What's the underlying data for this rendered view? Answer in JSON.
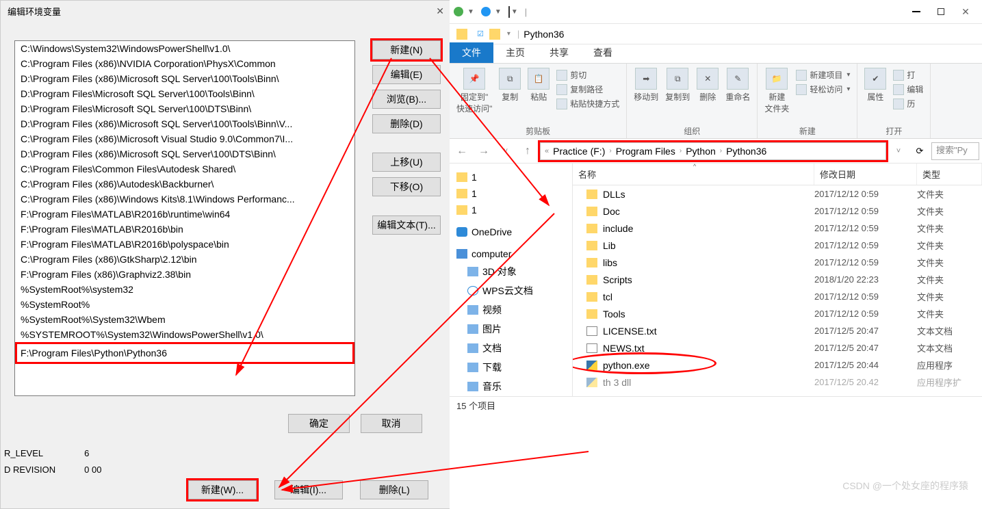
{
  "envdlg": {
    "title": "编辑环境变量",
    "items": [
      "C:\\Windows\\System32\\WindowsPowerShell\\v1.0\\",
      "C:\\Program Files (x86)\\NVIDIA Corporation\\PhysX\\Common",
      "D:\\Program Files (x86)\\Microsoft SQL Server\\100\\Tools\\Binn\\",
      "D:\\Program Files\\Microsoft SQL Server\\100\\Tools\\Binn\\",
      "D:\\Program Files\\Microsoft SQL Server\\100\\DTS\\Binn\\",
      "D:\\Program Files (x86)\\Microsoft SQL Server\\100\\Tools\\Binn\\V...",
      "C:\\Program Files (x86)\\Microsoft Visual Studio 9.0\\Common7\\I...",
      "D:\\Program Files (x86)\\Microsoft SQL Server\\100\\DTS\\Binn\\",
      "C:\\Program Files\\Common Files\\Autodesk Shared\\",
      "C:\\Program Files (x86)\\Autodesk\\Backburner\\",
      "C:\\Program Files (x86)\\Windows Kits\\8.1\\Windows Performanc...",
      "F:\\Program Files\\MATLAB\\R2016b\\runtime\\win64",
      "F:\\Program Files\\MATLAB\\R2016b\\bin",
      "F:\\Program Files\\MATLAB\\R2016b\\polyspace\\bin",
      "C:\\Program Files (x86)\\GtkSharp\\2.12\\bin",
      "F:\\Program Files (x86)\\Graphviz2.38\\bin",
      "%SystemRoot%\\system32",
      "%SystemRoot%",
      "%SystemRoot%\\System32\\Wbem",
      "%SYSTEMROOT%\\System32\\WindowsPowerShell\\v1.0\\",
      "F:\\Program Files\\Python\\Python36"
    ],
    "btns": {
      "new": "新建(N)",
      "edit": "编辑(E)",
      "browse": "浏览(B)...",
      "delete": "删除(D)",
      "up": "上移(U)",
      "down": "下移(O)",
      "edittext": "编辑文本(T)...",
      "ok": "确定",
      "cancel": "取消"
    }
  },
  "bgvals": {
    "row1_name": "R_LEVEL",
    "row1_val": "6",
    "row2_name": "D   REVISION",
    "row2_val": "0  00"
  },
  "bottom": {
    "new": "新建(W)...",
    "edit": "编辑(I)...",
    "delete": "删除(L)"
  },
  "explorer": {
    "windowTitle": "Python36",
    "tabs": {
      "file": "文件",
      "home": "主页",
      "share": "共享",
      "view": "查看"
    },
    "ribbon": {
      "pin": "固定到\"\n快速访问\"",
      "copy": "复制",
      "paste": "粘贴",
      "cut": "剪切",
      "copypath": "复制路径",
      "pasteshortcut": "粘贴快捷方式",
      "clipboard": "剪贴板",
      "moveto": "移动到",
      "copyto": "复制到",
      "delete": "删除",
      "rename": "重命名",
      "organize": "组织",
      "newfolder": "新建\n文件夹",
      "newitem": "新建项目",
      "easyaccess": "轻松访问",
      "new": "新建",
      "properties": "属性",
      "open_s": "打",
      "edit_s": "编辑",
      "history_s": "历",
      "open": "打开"
    },
    "breadcrumb": [
      "Practice (F:)",
      "Program Files",
      "Python",
      "Python36"
    ],
    "searchPlaceholder": "搜索\"Py",
    "tree": {
      "one": "1",
      "one2": "1",
      "one3": "1",
      "onedrive": "OneDrive",
      "computer": "computer",
      "threeD": "3D 对象",
      "wps": "WPS云文档",
      "video": "视频",
      "pictures": "图片",
      "docs": "文档",
      "downloads": "下载",
      "music": "音乐"
    },
    "columns": {
      "name": "名称",
      "date": "修改日期",
      "type": "类型"
    },
    "files": [
      {
        "name": "DLLs",
        "date": "2017/12/12 0:59",
        "type": "文件夹",
        "icon": "folder"
      },
      {
        "name": "Doc",
        "date": "2017/12/12 0:59",
        "type": "文件夹",
        "icon": "folder"
      },
      {
        "name": "include",
        "date": "2017/12/12 0:59",
        "type": "文件夹",
        "icon": "folder"
      },
      {
        "name": "Lib",
        "date": "2017/12/12 0:59",
        "type": "文件夹",
        "icon": "folder"
      },
      {
        "name": "libs",
        "date": "2017/12/12 0:59",
        "type": "文件夹",
        "icon": "folder"
      },
      {
        "name": "Scripts",
        "date": "2018/1/20 22:23",
        "type": "文件夹",
        "icon": "folder"
      },
      {
        "name": "tcl",
        "date": "2017/12/12 0:59",
        "type": "文件夹",
        "icon": "folder"
      },
      {
        "name": "Tools",
        "date": "2017/12/12 0:59",
        "type": "文件夹",
        "icon": "folder"
      },
      {
        "name": "LICENSE.txt",
        "date": "2017/12/5 20:47",
        "type": "文本文档",
        "icon": "txt"
      },
      {
        "name": "NEWS.txt",
        "date": "2017/12/5 20:47",
        "type": "文本文档",
        "icon": "txt"
      },
      {
        "name": "python.exe",
        "date": "2017/12/5 20:44",
        "type": "应用程序",
        "icon": "exe",
        "highlight": true
      }
    ],
    "cutoff": {
      "name": "    th    3  dll",
      "date": "2017/12/5 20.42",
      "type": "应用程序扩"
    },
    "status": "15 个项目"
  },
  "watermark": "CSDN @一个处女座的程序猿"
}
